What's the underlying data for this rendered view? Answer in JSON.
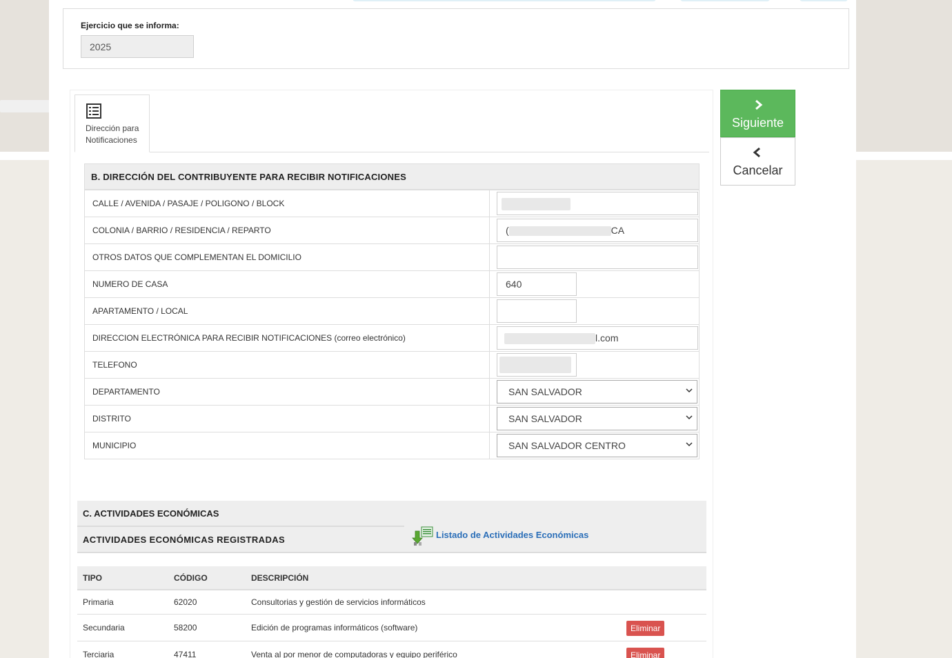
{
  "exercise": {
    "label": "Ejercicio que se informa:",
    "value": "2025"
  },
  "tab": {
    "icon": "list-icon",
    "label_line1": "Dirección para",
    "label_line2": "Notificaciones"
  },
  "section_b": {
    "title": "B. DIRECCIÓN DEL CONTRIBUYENTE PARA RECIBIR NOTIFICACIONES",
    "rows": [
      {
        "label": "CALLE / AVENIDA / PASAJE / POLIGONO / BLOCK",
        "value": ""
      },
      {
        "label": "COLONIA / BARRIO / RESIDENCIA / REPARTO",
        "value_prefix": "(",
        "value_suffix": "CA"
      },
      {
        "label": "OTROS DATOS QUE COMPLEMENTAN EL DOMICILIO",
        "value": ""
      },
      {
        "label": "NUMERO DE CASA",
        "value": "640"
      },
      {
        "label": "APARTAMENTO / LOCAL",
        "value": ""
      },
      {
        "label": "DIRECCION ELECTRÓNICA PARA RECIBIR NOTIFICACIONES",
        "label_note": "(correo electrónico)",
        "value_suffix": "l.com"
      },
      {
        "label": "TELEFONO",
        "value": ""
      },
      {
        "label": "DEPARTAMENTO",
        "selected": "SAN SALVADOR"
      },
      {
        "label": "DISTRITO",
        "selected": "SAN SALVADOR"
      },
      {
        "label": "MUNICIPIO",
        "selected": "SAN SALVADOR CENTRO"
      }
    ]
  },
  "section_c": {
    "title": "C. ACTIVIDADES ECONÓMICAS",
    "subtitle": "ACTIVIDADES ECONÓMICAS REGISTRADAS",
    "list_link": "Listado de Actividades Económicas",
    "list_icon": "download-excel-icon",
    "columns": {
      "tipo": "TIPO",
      "codigo": "CÓDIGO",
      "descripcion": "DESCRIPCIÓN"
    },
    "delete_label": "Eliminar",
    "rows": [
      {
        "tipo": "Primaria",
        "codigo": "62020",
        "descripcion": "Consultorias y gestión de servicios informáticos"
      },
      {
        "tipo": "Secundaria",
        "codigo": "58200",
        "descripcion": "Edición de programas informáticos (software)"
      },
      {
        "tipo": "Terciaria",
        "codigo": "47411",
        "descripcion": "Venta al por menor de computadoras y equipo periférico"
      }
    ]
  },
  "actions": {
    "next_label": "Siguiente",
    "next_icon": "chevron-right-icon",
    "cancel_label": "Cancelar",
    "cancel_icon": "chevron-left-icon"
  },
  "colors": {
    "next_button": "#5cb85c",
    "delete_button": "#d9534f",
    "link": "#2a6eb8",
    "section_header_bg": "#eeeeee"
  }
}
